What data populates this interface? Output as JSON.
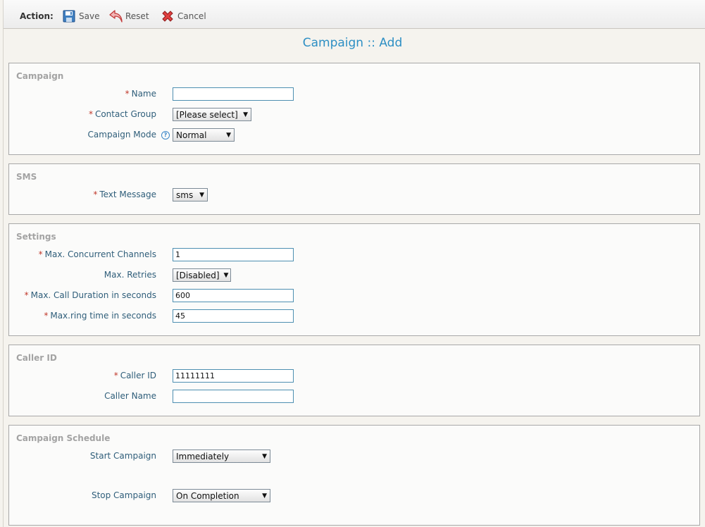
{
  "toolbar": {
    "action_label": "Action:",
    "save_label": "Save",
    "reset_label": "Reset",
    "cancel_label": "Cancel"
  },
  "page_title": "Campaign :: Add",
  "sections": {
    "campaign": {
      "title": "Campaign",
      "name_label": "Name",
      "name_value": "",
      "contact_group_label": "Contact Group",
      "contact_group_value": "[Please select]",
      "mode_label": "Campaign Mode",
      "mode_value": "Normal"
    },
    "sms": {
      "title": "SMS",
      "text_message_label": "Text Message",
      "text_message_value": "sms"
    },
    "settings": {
      "title": "Settings",
      "max_channels_label": "Max. Concurrent Channels",
      "max_channels_value": "1",
      "max_retries_label": "Max. Retries",
      "max_retries_value": "[Disabled]",
      "max_duration_label": "Max. Call Duration in seconds",
      "max_duration_value": "600",
      "max_ring_label": "Max.ring time in seconds",
      "max_ring_value": "45"
    },
    "caller_id": {
      "title": "Caller ID",
      "caller_id_label": "Caller ID",
      "caller_id_value": "11111111",
      "caller_name_label": "Caller Name",
      "caller_name_value": ""
    },
    "schedule": {
      "title": "Campaign Schedule",
      "start_label": "Start Campaign",
      "start_value": "Immediately",
      "stop_label": "Stop Campaign",
      "stop_value": "On Completion"
    }
  },
  "required_mark": "*",
  "help_mark": "?",
  "dropdown_arrow": "▼",
  "colors": {
    "title_blue": "#2d8fc4",
    "label_blue": "#2f5e7a",
    "required_red": "#c0392b",
    "section_title_gray": "#a3a3a3",
    "input_border": "#4e8fb1"
  },
  "icons": {
    "save": "floppy-disk-icon",
    "reset": "undo-arrow-icon",
    "cancel": "red-x-icon",
    "help": "question-circle-icon"
  }
}
